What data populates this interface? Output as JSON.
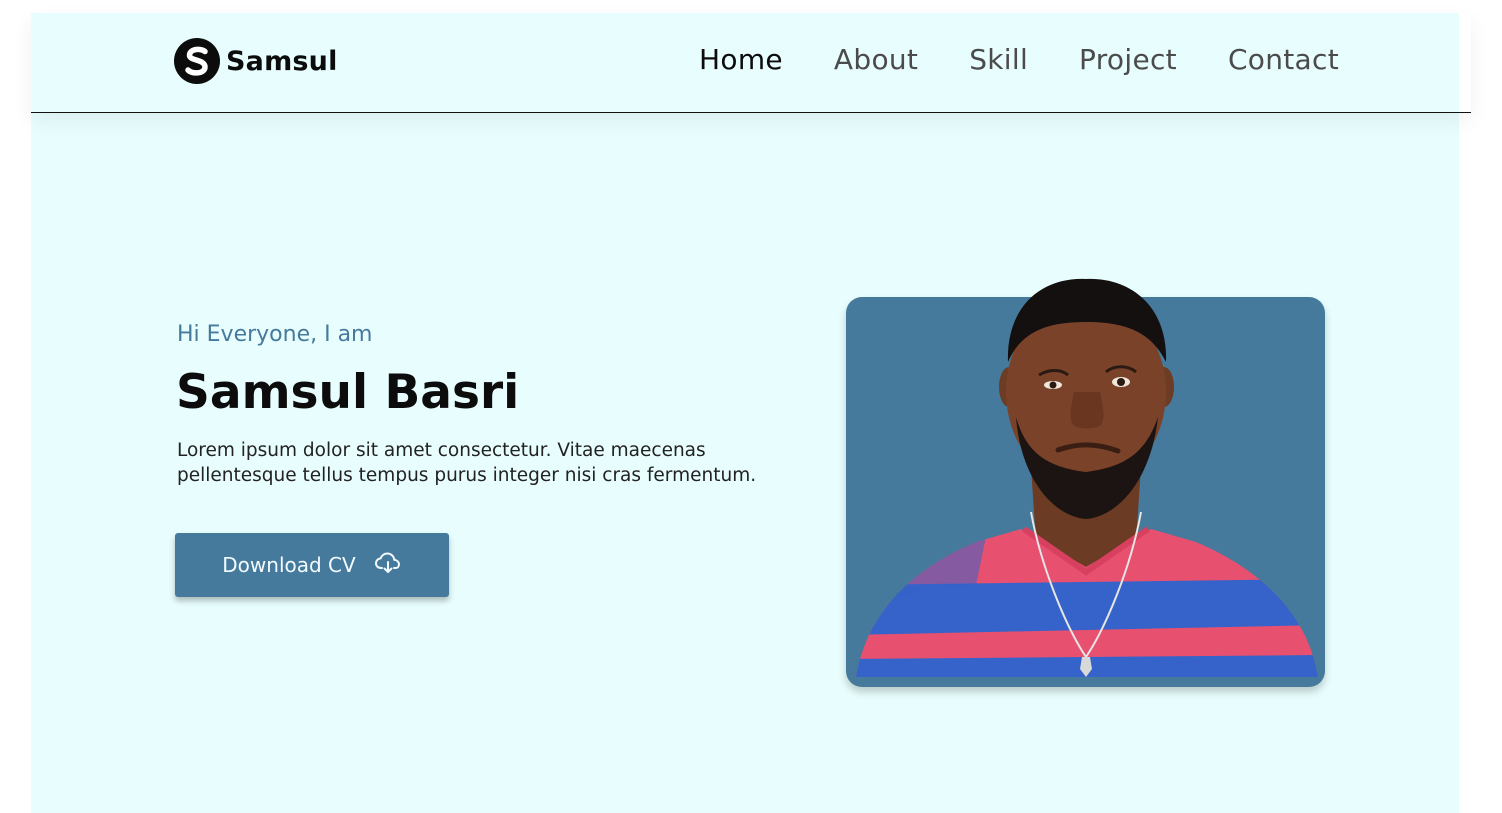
{
  "header": {
    "logo_text": "Samsul",
    "logo_icon": "s-letter-logo-icon",
    "nav": [
      {
        "label": "Home",
        "active": true
      },
      {
        "label": "About",
        "active": false
      },
      {
        "label": "Skill",
        "active": false
      },
      {
        "label": "Project",
        "active": false
      },
      {
        "label": "Contact",
        "active": false
      }
    ]
  },
  "hero": {
    "greeting": "Hi Everyone, I am",
    "name": "Samsul Basri",
    "description": "Lorem ipsum dolor sit amet consectetur. Vitae maecenas pellentesque tellus tempus purus integer nisi cras fermentum.",
    "cta_label": "Download CV",
    "cta_icon": "cloud-download-icon"
  },
  "colors": {
    "background": "#e8fdfd",
    "accent": "#467a9c",
    "text": "#0c0c0c",
    "shirt_pink": "#e8506f",
    "shirt_blue": "#3563c9"
  }
}
